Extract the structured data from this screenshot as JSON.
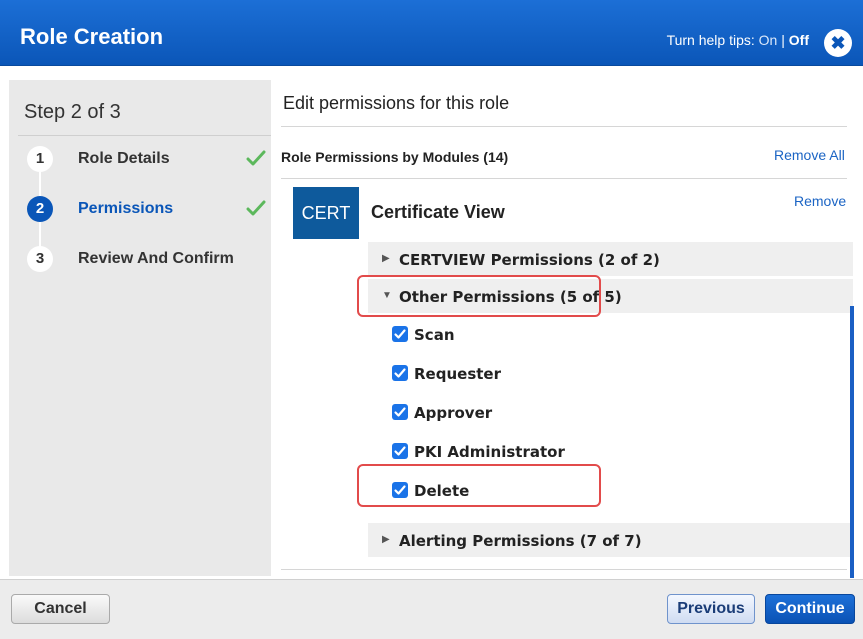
{
  "dialog": {
    "title": "Role Creation",
    "help_prefix": "Turn help tips: ",
    "help_on": "On",
    "help_sep": " | ",
    "help_off": "Off",
    "close_icon": "close-icon"
  },
  "steps": {
    "title": "Step 2 of 3",
    "items": [
      {
        "num": "1",
        "label": "Role Details",
        "done": true
      },
      {
        "num": "2",
        "label": "Permissions",
        "done": true,
        "active": true
      },
      {
        "num": "3",
        "label": "Review And Confirm",
        "done": false
      }
    ]
  },
  "main": {
    "heading": "Edit permissions for this role",
    "modules_title": "Role Permissions by Modules (14)",
    "remove_all": "Remove All",
    "module": {
      "logo": "CERT",
      "name": "Certificate View",
      "remove": "Remove",
      "groups": [
        {
          "label": "CERTVIEW Permissions (2 of 2)",
          "expanded": false
        },
        {
          "label": "Other Permissions (5 of 5)",
          "expanded": true
        },
        {
          "label": "Alerting Permissions (7 of 7)",
          "expanded": false
        }
      ],
      "permissions": [
        {
          "label": "Scan",
          "checked": true
        },
        {
          "label": "Requester",
          "checked": true
        },
        {
          "label": "Approver",
          "checked": true
        },
        {
          "label": "PKI Administrator",
          "checked": true
        },
        {
          "label": "Delete",
          "checked": true
        }
      ]
    }
  },
  "footer": {
    "cancel": "Cancel",
    "previous": "Previous",
    "continue": "Continue"
  },
  "colors": {
    "header_blue": "#0b56b8",
    "accent_blue": "#1a73e8",
    "check_green": "#5cb85c",
    "highlight_red": "#e24b4b"
  }
}
